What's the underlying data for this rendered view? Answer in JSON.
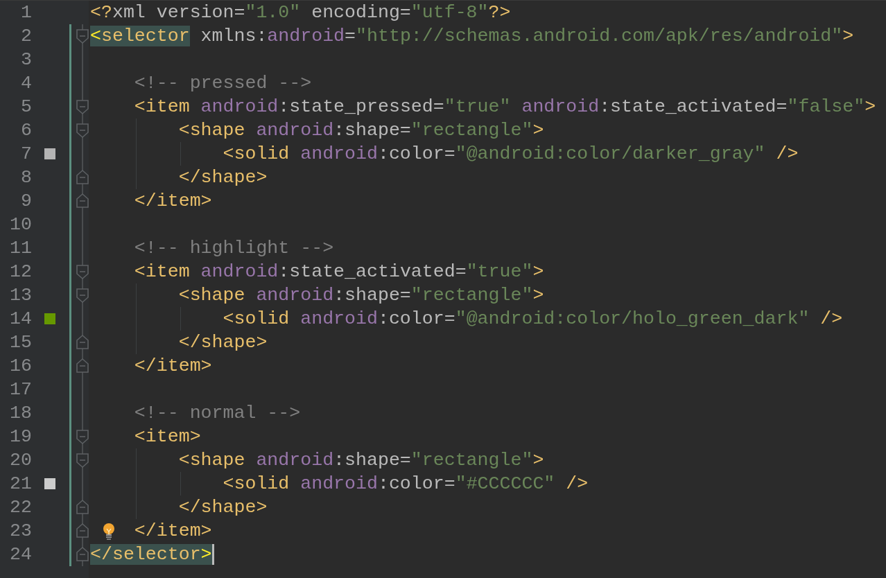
{
  "lines": [
    {
      "no": "1",
      "kind": "plain",
      "changed": false,
      "bulb": false,
      "caret": false,
      "tokens": [
        {
          "kind": "tag",
          "text": "<?",
          "hl": false
        },
        {
          "kind": "attr",
          "text": "xml version=",
          "hl": false
        },
        {
          "kind": "string",
          "text": "\"1.0\"",
          "hl": false
        },
        {
          "kind": "attr",
          "text": " encoding=",
          "hl": false
        },
        {
          "kind": "string",
          "text": "\"utf-8\"",
          "hl": false
        },
        {
          "kind": "tag",
          "text": "?>",
          "hl": false
        }
      ]
    },
    {
      "no": "2",
      "kind": "fold-start",
      "changed": true,
      "bulb": false,
      "caret": false,
      "tokens": [
        {
          "kind": "brace",
          "text": "<",
          "hl": true
        },
        {
          "kind": "tag",
          "text": "selector",
          "hl": true
        },
        {
          "kind": "attr",
          "text": " xmlns:",
          "hl": false
        },
        {
          "kind": "ns",
          "text": "android",
          "hl": false
        },
        {
          "kind": "attr",
          "text": "=",
          "hl": false
        },
        {
          "kind": "string",
          "text": "\"http://schemas.android.com/apk/res/android\"",
          "hl": false
        },
        {
          "kind": "tag",
          "text": ">",
          "hl": false
        }
      ]
    },
    {
      "no": "3",
      "kind": "plain",
      "changed": true,
      "bulb": false,
      "caret": false
    },
    {
      "no": "4",
      "kind": "plain",
      "changed": true,
      "bulb": false,
      "caret": false,
      "tokens": [
        {
          "kind": "comment",
          "text": "    <!-- pressed -->",
          "hl": false
        }
      ]
    },
    {
      "no": "5",
      "kind": "fold-start",
      "changed": true,
      "bulb": false,
      "caret": false,
      "tokens": [
        {
          "kind": "tag",
          "text": "    <item ",
          "hl": false
        },
        {
          "kind": "ns",
          "text": "android",
          "hl": false
        },
        {
          "kind": "attr",
          "text": ":state_pressed=",
          "hl": false
        },
        {
          "kind": "string",
          "text": "\"true\" ",
          "hl": false
        },
        {
          "kind": "ns",
          "text": "android",
          "hl": false
        },
        {
          "kind": "attr",
          "text": ":state_activated=",
          "hl": false
        },
        {
          "kind": "string",
          "text": "\"false\"",
          "hl": false
        },
        {
          "kind": "tag",
          "text": ">",
          "hl": false
        }
      ]
    },
    {
      "no": "6",
      "kind": "fold-start",
      "changed": true,
      "bulb": false,
      "caret": false,
      "tokens": [
        {
          "kind": "tag",
          "text": "        <shape ",
          "hl": false
        },
        {
          "kind": "ns",
          "text": "android",
          "hl": false
        },
        {
          "kind": "attr",
          "text": ":shape=",
          "hl": false
        },
        {
          "kind": "string",
          "text": "\"rectangle\"",
          "hl": false
        },
        {
          "kind": "tag",
          "text": ">",
          "hl": false
        }
      ]
    },
    {
      "no": "7",
      "kind": "plain",
      "changed": true,
      "bulb": false,
      "caret": false,
      "color": "#b4b4b4",
      "tokens": [
        {
          "kind": "tag",
          "text": "            <solid ",
          "hl": false
        },
        {
          "kind": "ns",
          "text": "android",
          "hl": false
        },
        {
          "kind": "attr",
          "text": ":color=",
          "hl": false
        },
        {
          "kind": "string",
          "text": "\"@android:color/darker_gray\"",
          "hl": false
        },
        {
          "kind": "tag",
          "text": " />",
          "hl": false
        }
      ]
    },
    {
      "no": "8",
      "kind": "fold-end",
      "changed": true,
      "bulb": false,
      "caret": false,
      "tokens": [
        {
          "kind": "tag",
          "text": "        </shape>",
          "hl": false
        }
      ]
    },
    {
      "no": "9",
      "kind": "fold-end",
      "changed": true,
      "bulb": false,
      "caret": false,
      "tokens": [
        {
          "kind": "tag",
          "text": "    </item>",
          "hl": false
        }
      ]
    },
    {
      "no": "10",
      "kind": "plain",
      "changed": true,
      "bulb": false,
      "caret": false
    },
    {
      "no": "11",
      "kind": "plain",
      "changed": true,
      "bulb": false,
      "caret": false,
      "tokens": [
        {
          "kind": "comment",
          "text": "    <!-- highlight -->",
          "hl": false
        }
      ]
    },
    {
      "no": "12",
      "kind": "fold-start",
      "changed": true,
      "bulb": false,
      "caret": false,
      "tokens": [
        {
          "kind": "tag",
          "text": "    <item ",
          "hl": false
        },
        {
          "kind": "ns",
          "text": "android",
          "hl": false
        },
        {
          "kind": "attr",
          "text": ":state_activated=",
          "hl": false
        },
        {
          "kind": "string",
          "text": "\"true\"",
          "hl": false
        },
        {
          "kind": "tag",
          "text": ">",
          "hl": false
        }
      ]
    },
    {
      "no": "13",
      "kind": "fold-start",
      "changed": true,
      "bulb": false,
      "caret": false,
      "tokens": [
        {
          "kind": "tag",
          "text": "        <shape ",
          "hl": false
        },
        {
          "kind": "ns",
          "text": "android",
          "hl": false
        },
        {
          "kind": "attr",
          "text": ":shape=",
          "hl": false
        },
        {
          "kind": "string",
          "text": "\"rectangle\"",
          "hl": false
        },
        {
          "kind": "tag",
          "text": ">",
          "hl": false
        }
      ]
    },
    {
      "no": "14",
      "kind": "plain",
      "changed": true,
      "bulb": false,
      "caret": false,
      "color": "#669900",
      "tokens": [
        {
          "kind": "tag",
          "text": "            <solid ",
          "hl": false
        },
        {
          "kind": "ns",
          "text": "android",
          "hl": false
        },
        {
          "kind": "attr",
          "text": ":color=",
          "hl": false
        },
        {
          "kind": "string",
          "text": "\"@android:color/holo_green_dark\"",
          "hl": false
        },
        {
          "kind": "tag",
          "text": " />",
          "hl": false
        }
      ]
    },
    {
      "no": "15",
      "kind": "fold-end",
      "changed": true,
      "bulb": false,
      "caret": false,
      "tokens": [
        {
          "kind": "tag",
          "text": "        </shape>",
          "hl": false
        }
      ]
    },
    {
      "no": "16",
      "kind": "fold-end",
      "changed": true,
      "bulb": false,
      "caret": false,
      "tokens": [
        {
          "kind": "tag",
          "text": "    </item>",
          "hl": false
        }
      ]
    },
    {
      "no": "17",
      "kind": "plain",
      "changed": true,
      "bulb": false,
      "caret": false
    },
    {
      "no": "18",
      "kind": "plain",
      "changed": true,
      "bulb": false,
      "caret": false,
      "tokens": [
        {
          "kind": "comment",
          "text": "    <!-- normal -->",
          "hl": false
        }
      ]
    },
    {
      "no": "19",
      "kind": "fold-start",
      "changed": true,
      "bulb": false,
      "caret": false,
      "tokens": [
        {
          "kind": "tag",
          "text": "    <item>",
          "hl": false
        }
      ]
    },
    {
      "no": "20",
      "kind": "fold-start",
      "changed": true,
      "bulb": false,
      "caret": false,
      "tokens": [
        {
          "kind": "tag",
          "text": "        <shape ",
          "hl": false
        },
        {
          "kind": "ns",
          "text": "android",
          "hl": false
        },
        {
          "kind": "attr",
          "text": ":shape=",
          "hl": false
        },
        {
          "kind": "string",
          "text": "\"rectangle\"",
          "hl": false
        },
        {
          "kind": "tag",
          "text": ">",
          "hl": false
        }
      ]
    },
    {
      "no": "21",
      "kind": "plain",
      "changed": true,
      "bulb": false,
      "caret": false,
      "color": "#cccccc",
      "tokens": [
        {
          "kind": "tag",
          "text": "            <solid ",
          "hl": false
        },
        {
          "kind": "ns",
          "text": "android",
          "hl": false
        },
        {
          "kind": "attr",
          "text": ":color=",
          "hl": false
        },
        {
          "kind": "string",
          "text": "\"#CCCCCC\"",
          "hl": false
        },
        {
          "kind": "tag",
          "text": " />",
          "hl": false
        }
      ]
    },
    {
      "no": "22",
      "kind": "fold-end",
      "changed": true,
      "bulb": false,
      "caret": false,
      "tokens": [
        {
          "kind": "tag",
          "text": "        </shape>",
          "hl": false
        }
      ]
    },
    {
      "no": "23",
      "kind": "fold-end",
      "changed": true,
      "bulb": true,
      "caret": false,
      "tokens": [
        {
          "kind": "tag",
          "text": "    </item>",
          "hl": false
        }
      ]
    },
    {
      "no": "24",
      "kind": "fold-end",
      "changed": true,
      "bulb": false,
      "caret": true,
      "tokens": [
        {
          "kind": "tag",
          "text": "</selector",
          "hl": true
        },
        {
          "kind": "brace",
          "text": ">",
          "hl": true
        }
      ]
    }
  ]
}
